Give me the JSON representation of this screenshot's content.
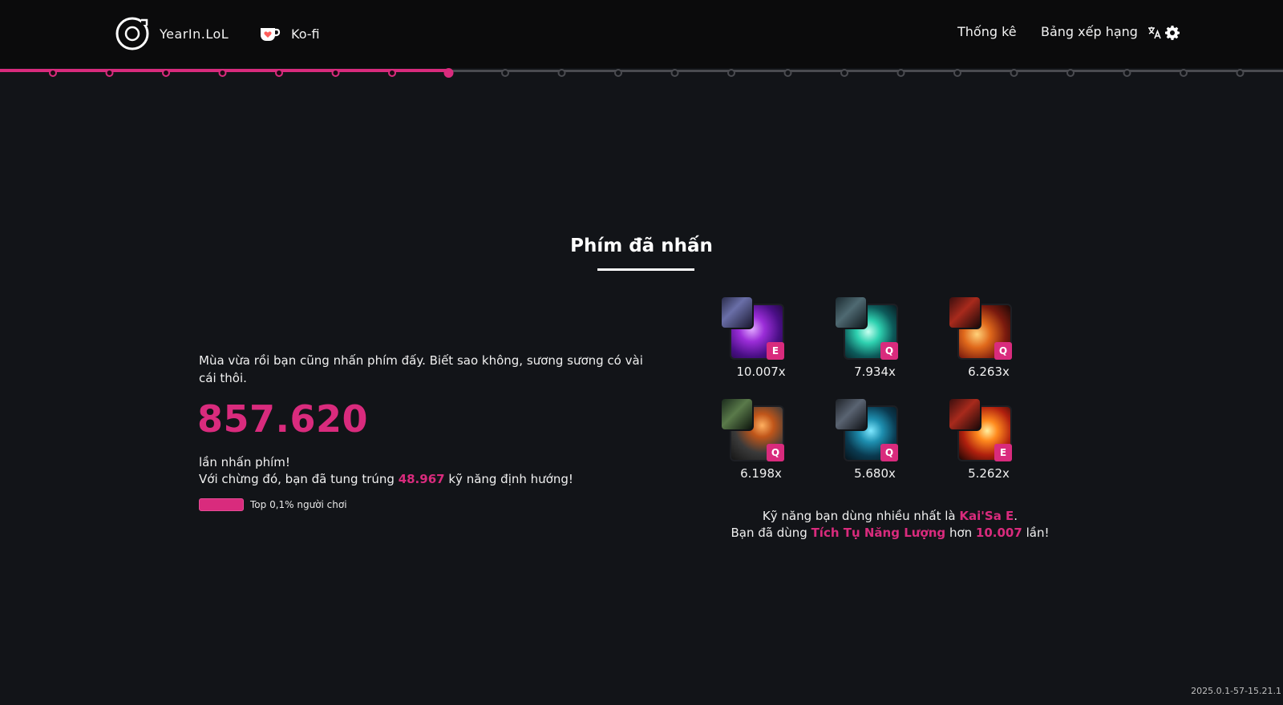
{
  "header": {
    "brand": "YearIn.LoL",
    "kofi": "Ko-fi",
    "nav_stats": "Thống kê",
    "nav_ranking": "Bảng xếp hạng"
  },
  "timeline": {
    "total_steps": 23,
    "completed_steps": 8,
    "accent_color": "#d92b7d",
    "inactive_color": "#4a4b50"
  },
  "section": {
    "title": "Phím đã nhấn",
    "intro": "Mùa vừa rồi bạn cũng nhấn phím đấy. Biết sao không, sương sương có vài cái thôi.",
    "total_presses": "857.620",
    "presses_label": "lần nhấn phím!",
    "skillshot_prefix": "Với chừng đó, bạn đã tung trúng",
    "skillshots": "48.967",
    "skillshot_suffix": "kỹ năng định hướng!",
    "top_badge": "Top 0,1% người chơi"
  },
  "skills": [
    {
      "key": "E",
      "count": "10.007x",
      "theme": "purple"
    },
    {
      "key": "Q",
      "count": "7.934x",
      "theme": "teal"
    },
    {
      "key": "Q",
      "count": "6.263x",
      "theme": "red"
    },
    {
      "key": "Q",
      "count": "6.198x",
      "theme": "green"
    },
    {
      "key": "Q",
      "count": "5.680x",
      "theme": "cyan"
    },
    {
      "key": "E",
      "count": "5.262x",
      "theme": "fire"
    }
  ],
  "summary": {
    "line1_prefix": "Kỹ năng bạn dùng nhiều nhất là",
    "top_skill": "Kai'Sa E",
    "line1_suffix": ".",
    "line2_prefix": "Bạn đã dùng",
    "skill_name": "Tích Tụ Năng Lượng",
    "line2_mid": "hơn",
    "times": "10.007",
    "line2_suffix": "lần!"
  },
  "version": "2025.0.1-57-15.21.1"
}
